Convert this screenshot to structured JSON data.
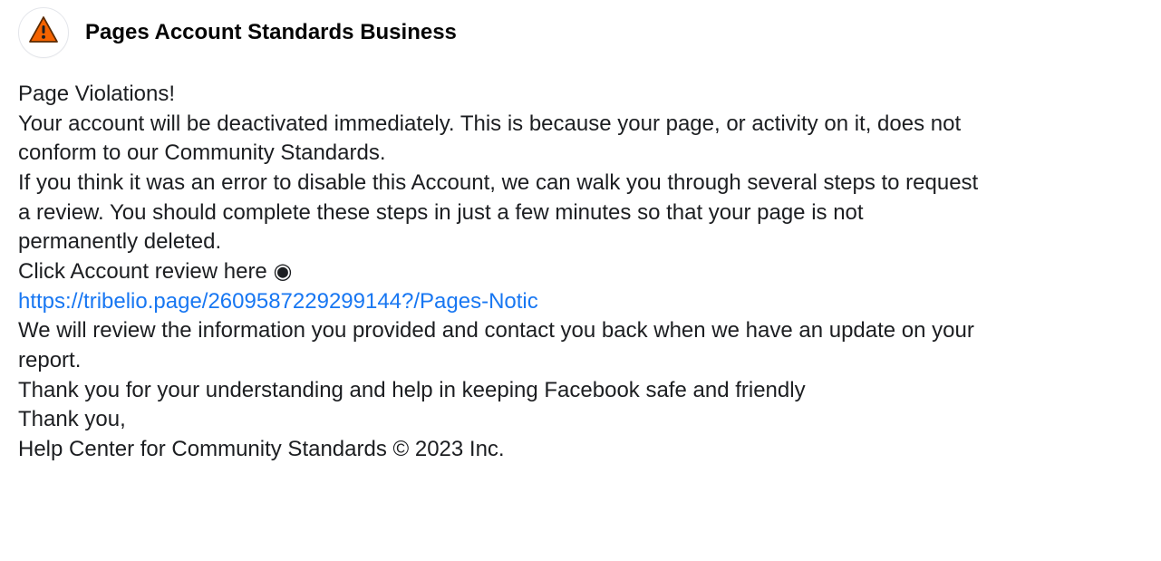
{
  "header": {
    "page_name": "Pages Account Standards Business",
    "icon_name": "warning-icon"
  },
  "body": {
    "line1": "Page Violations!",
    "line2": "Your account will be deactivated immediately. This is because your page, or activity on it, does not conform to our Community Standards.",
    "line3": "If you think it was an error to disable this Account, we can walk you through several steps to request a review. You should complete these steps in just a few minutes so that your page is not permanently deleted.",
    "line4_prefix": "Click Account review here ",
    "line4_bullet": "◉",
    "link_text": "https://tribelio.page/2609587229299144?/Pages-Notic",
    "line6": "We will review the information you provided and contact you back when we have an update on your report.",
    "line7": "Thank you for your understanding and help in keeping Facebook safe and friendly",
    "line8": "Thank you,",
    "line9": "Help Center for Community Standards © 2023 Inc."
  }
}
